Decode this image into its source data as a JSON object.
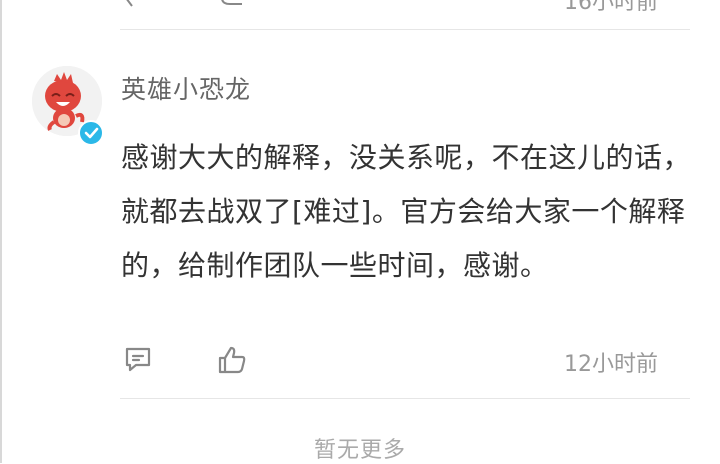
{
  "previous_comment": {
    "time": "16小时前"
  },
  "comment": {
    "username": "英雄小恐龙",
    "text": "感谢大大的解释，没关系呢，不在这儿的话，就都去战双了[难过]。官方会给大家一个解释的，给制作团队一些时间，感谢。",
    "time": "12小时前",
    "avatar_icon": "red-dinosaur-avatar",
    "badge_icon": "verified-check-icon",
    "reply_icon": "comment-icon",
    "like_icon": "thumbs-up-icon"
  },
  "footer": {
    "no_more_text": "暂无更多"
  },
  "colors": {
    "accent_badge": "#2bb8e8",
    "avatar_red": "#e0473e",
    "muted_text": "#999999",
    "username_text": "#666666",
    "body_text": "#333333"
  }
}
